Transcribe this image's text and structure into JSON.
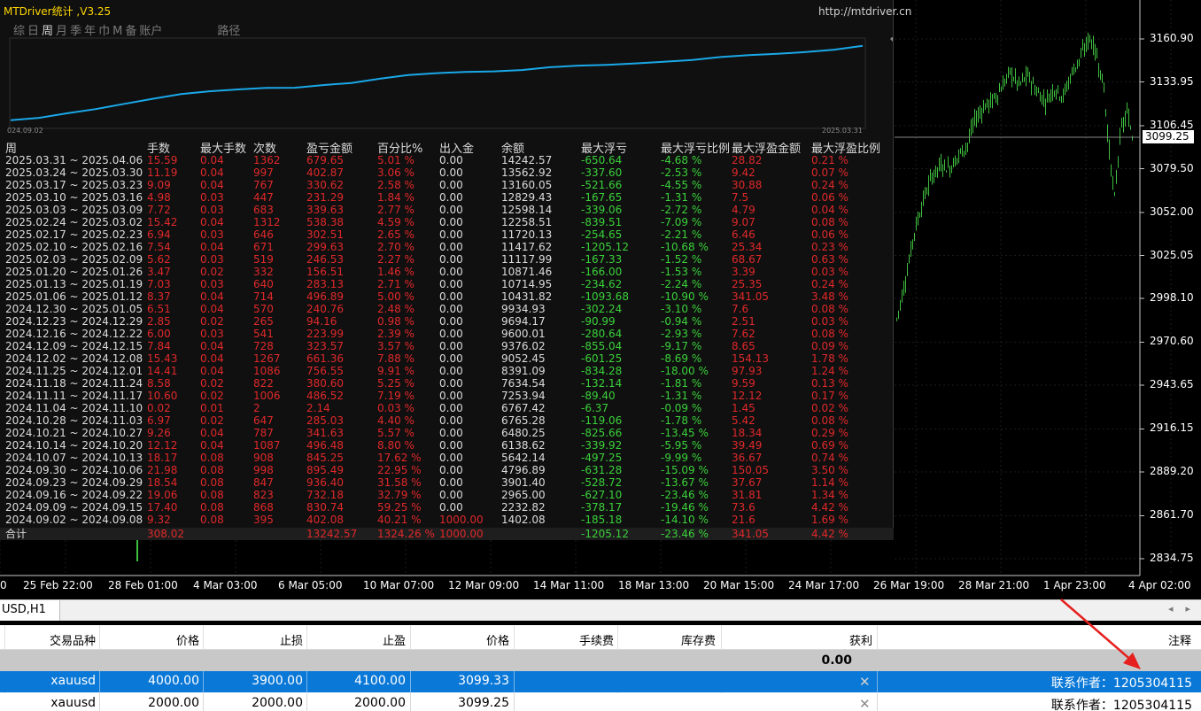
{
  "panel": {
    "title": "MTDriver统计 ,V3.25",
    "url": "http://mtdriver.cn",
    "tabs": [
      "综",
      "日",
      "周",
      "月",
      "季",
      "年",
      "巾",
      "M",
      "备",
      "账户",
      "路径"
    ],
    "active_tab": "周",
    "equity_start_label": "024.09.02",
    "equity_end_label": "2025.03.31",
    "headers": [
      "周",
      "手数",
      "最大手数",
      "次数",
      "盈亏金额",
      "百分比%",
      "出入金",
      "余额",
      "最大浮亏",
      "最大浮亏比例",
      "最大浮盈金额",
      "最大浮盈比例"
    ],
    "rows": [
      [
        "2025.03.31 ~ 2025.04.06",
        "15.59",
        "0.04",
        "1362",
        "679.65",
        "5.01 %",
        "0.00",
        "14242.57",
        "-650.64",
        "-4.68 %",
        "28.82",
        "0.21 %"
      ],
      [
        "2025.03.24 ~ 2025.03.30",
        "11.19",
        "0.04",
        "997",
        "402.87",
        "3.06 %",
        "0.00",
        "13562.92",
        "-337.60",
        "-2.53 %",
        "9.42",
        "0.07 %"
      ],
      [
        "2025.03.17 ~ 2025.03.23",
        "9.09",
        "0.04",
        "767",
        "330.62",
        "2.58 %",
        "0.00",
        "13160.05",
        "-521.66",
        "-4.55 %",
        "30.88",
        "0.24 %"
      ],
      [
        "2025.03.10 ~ 2025.03.16",
        "4.98",
        "0.03",
        "447",
        "231.29",
        "1.84 %",
        "0.00",
        "12829.43",
        "-167.65",
        "-1.31 %",
        "7.5",
        "0.06 %"
      ],
      [
        "2025.03.03 ~ 2025.03.09",
        "7.72",
        "0.03",
        "683",
        "339.63",
        "2.77 %",
        "0.00",
        "12598.14",
        "-339.06",
        "-2.72 %",
        "4.79",
        "0.04 %"
      ],
      [
        "2025.02.24 ~ 2025.03.02",
        "15.42",
        "0.04",
        "1312",
        "538.38",
        "4.59 %",
        "0.00",
        "12258.51",
        "-839.51",
        "-7.09 %",
        "9.07",
        "0.08 %"
      ],
      [
        "2025.02.17 ~ 2025.02.23",
        "6.94",
        "0.03",
        "646",
        "302.51",
        "2.65 %",
        "0.00",
        "11720.13",
        "-254.65",
        "-2.21 %",
        "6.46",
        "0.06 %"
      ],
      [
        "2025.02.10 ~ 2025.02.16",
        "7.54",
        "0.04",
        "671",
        "299.63",
        "2.70 %",
        "0.00",
        "11417.62",
        "-1205.12",
        "-10.68 %",
        "25.34",
        "0.23 %"
      ],
      [
        "2025.02.03 ~ 2025.02.09",
        "5.62",
        "0.03",
        "519",
        "246.53",
        "2.27 %",
        "0.00",
        "11117.99",
        "-167.33",
        "-1.52 %",
        "68.67",
        "0.63 %"
      ],
      [
        "2025.01.20 ~ 2025.01.26",
        "3.47",
        "0.02",
        "332",
        "156.51",
        "1.46 %",
        "0.00",
        "10871.46",
        "-166.00",
        "-1.53 %",
        "3.39",
        "0.03 %"
      ],
      [
        "2025.01.13 ~ 2025.01.19",
        "7.03",
        "0.03",
        "640",
        "283.13",
        "2.71 %",
        "0.00",
        "10714.95",
        "-234.62",
        "-2.24 %",
        "25.35",
        "0.24 %"
      ],
      [
        "2025.01.06 ~ 2025.01.12",
        "8.37",
        "0.04",
        "714",
        "496.89",
        "5.00 %",
        "0.00",
        "10431.82",
        "-1093.68",
        "-10.90 %",
        "341.05",
        "3.48 %"
      ],
      [
        "2024.12.30 ~ 2025.01.05",
        "6.51",
        "0.04",
        "570",
        "240.76",
        "2.48 %",
        "0.00",
        "9934.93",
        "-302.24",
        "-3.10 %",
        "7.6",
        "0.08 %"
      ],
      [
        "2024.12.23 ~ 2024.12.29",
        "2.85",
        "0.02",
        "265",
        "94.16",
        "0.98 %",
        "0.00",
        "9694.17",
        "-90.99",
        "-0.94 %",
        "2.51",
        "0.03 %"
      ],
      [
        "2024.12.16 ~ 2024.12.22",
        "6.00",
        "0.03",
        "541",
        "223.99",
        "2.39 %",
        "0.00",
        "9600.01",
        "-280.64",
        "-2.93 %",
        "7.62",
        "0.08 %"
      ],
      [
        "2024.12.09 ~ 2024.12.15",
        "7.84",
        "0.04",
        "728",
        "323.57",
        "3.57 %",
        "0.00",
        "9376.02",
        "-855.04",
        "-9.17 %",
        "8.65",
        "0.09 %"
      ],
      [
        "2024.12.02 ~ 2024.12.08",
        "15.43",
        "0.04",
        "1267",
        "661.36",
        "7.88 %",
        "0.00",
        "9052.45",
        "-601.25",
        "-8.69 %",
        "154.13",
        "1.78 %"
      ],
      [
        "2024.11.25 ~ 2024.12.01",
        "14.41",
        "0.04",
        "1086",
        "756.55",
        "9.91 %",
        "0.00",
        "8391.09",
        "-834.28",
        "-18.00 %",
        "97.93",
        "1.24 %"
      ],
      [
        "2024.11.18 ~ 2024.11.24",
        "8.58",
        "0.02",
        "822",
        "380.60",
        "5.25 %",
        "0.00",
        "7634.54",
        "-132.14",
        "-1.81 %",
        "9.59",
        "0.13 %"
      ],
      [
        "2024.11.11 ~ 2024.11.17",
        "10.60",
        "0.02",
        "1006",
        "486.52",
        "7.19 %",
        "0.00",
        "7253.94",
        "-89.40",
        "-1.31 %",
        "12.12",
        "0.17 %"
      ],
      [
        "2024.11.04 ~ 2024.11.10",
        "0.02",
        "0.01",
        "2",
        "2.14",
        "0.03 %",
        "0.00",
        "6767.42",
        "-6.37",
        "-0.09 %",
        "1.45",
        "0.02 %"
      ],
      [
        "2024.10.28 ~ 2024.11.03",
        "6.97",
        "0.02",
        "647",
        "285.03",
        "4.40 %",
        "0.00",
        "6765.28",
        "-119.06",
        "-1.78 %",
        "5.42",
        "0.08 %"
      ],
      [
        "2024.10.21 ~ 2024.10.27",
        "9.26",
        "0.04",
        "787",
        "341.63",
        "5.57 %",
        "0.00",
        "6480.25",
        "-825.66",
        "-13.45 %",
        "18.34",
        "0.29 %"
      ],
      [
        "2024.10.14 ~ 2024.10.20",
        "12.12",
        "0.04",
        "1087",
        "496.48",
        "8.80 %",
        "0.00",
        "6138.62",
        "-339.92",
        "-5.95 %",
        "39.49",
        "0.69 %"
      ],
      [
        "2024.10.07 ~ 2024.10.13",
        "18.17",
        "0.08",
        "908",
        "845.25",
        "17.62 %",
        "0.00",
        "5642.14",
        "-497.25",
        "-9.99 %",
        "36.67",
        "0.74 %"
      ],
      [
        "2024.09.30 ~ 2024.10.06",
        "21.98",
        "0.08",
        "998",
        "895.49",
        "22.95 %",
        "0.00",
        "4796.89",
        "-631.28",
        "-15.09 %",
        "150.05",
        "3.50 %"
      ],
      [
        "2024.09.23 ~ 2024.09.29",
        "18.54",
        "0.08",
        "847",
        "936.40",
        "31.58 %",
        "0.00",
        "3901.40",
        "-528.72",
        "-13.67 %",
        "37.67",
        "1.14 %"
      ],
      [
        "2024.09.16 ~ 2024.09.22",
        "19.06",
        "0.08",
        "823",
        "732.18",
        "32.79 %",
        "0.00",
        "2965.00",
        "-627.10",
        "-23.46 %",
        "31.81",
        "1.34 %"
      ],
      [
        "2024.09.09 ~ 2024.09.15",
        "17.40",
        "0.08",
        "868",
        "830.74",
        "59.25 %",
        "0.00",
        "2232.82",
        "-378.17",
        "-19.46 %",
        "73.6",
        "4.42 %"
      ],
      [
        "2024.09.02 ~ 2024.09.08",
        "9.32",
        "0.08",
        "395",
        "402.08",
        "40.21 %",
        "1000.00",
        "1402.08",
        "-185.18",
        "-14.10 %",
        "21.6",
        "1.69 %"
      ]
    ],
    "total": [
      "合计",
      "308.02",
      "",
      "",
      "13242.57",
      "1324.26 %",
      "1000.00",
      "",
      "-1205.12",
      "-23.46 %",
      "341.05",
      "4.42 %"
    ]
  },
  "chart": {
    "price_axis": [
      "3160.90",
      "3133.95",
      "3106.45",
      "3079.50",
      "3052.00",
      "3025.05",
      "2998.10",
      "2970.60",
      "2943.65",
      "2916.15",
      "2889.20",
      "2861.70",
      "2834.75"
    ],
    "current_price": "3099.25",
    "time_axis": [
      "0",
      "25 Feb 22:00",
      "28 Feb 01:00",
      "4 Mar 03:00",
      "6 Mar 05:00",
      "10 Mar 07:00",
      "12 Mar 09:00",
      "14 Mar 11:00",
      "18 Mar 13:00",
      "20 Mar 15:00",
      "24 Mar 17:00",
      "26 Mar 19:00",
      "28 Mar 21:00",
      "1 Apr 23:00",
      "4 Apr 02:00"
    ]
  },
  "terminal": {
    "chart_tab": "USD,H1",
    "scroll_left": "◂",
    "scroll_right": "▸",
    "columns": [
      "交易品种",
      "价格",
      "止损",
      "止盈",
      "价格",
      "手续费",
      "库存费",
      "获利",
      "注释"
    ],
    "summary_profit": "0.00",
    "rows": [
      {
        "symbol": "xauusd",
        "price": "4000.00",
        "sl": "3900.00",
        "tp": "4100.00",
        "cur": "3099.33",
        "comment": "联系作者：1205304115",
        "selected": true
      },
      {
        "symbol": "xauusd",
        "price": "2000.00",
        "sl": "2000.00",
        "tp": "2000.00",
        "cur": "3099.25",
        "comment": "联系作者：1205304115",
        "selected": false
      }
    ]
  },
  "colors": {
    "loss": "#e0282a",
    "gain": "#3ad13a",
    "equity_line": "#1aa8e8",
    "candle": "#3fbf3f",
    "selection": "#0a78d7",
    "arrow": "#e5201f"
  }
}
